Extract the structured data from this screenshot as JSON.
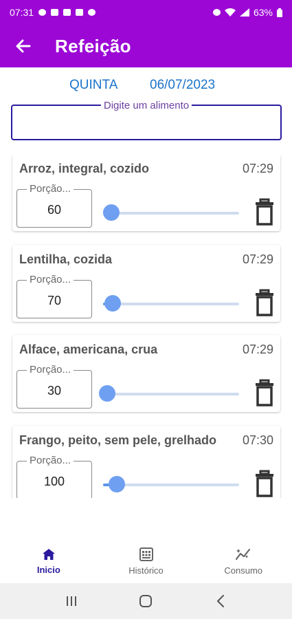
{
  "status_bar": {
    "time": "07:31",
    "battery": "63%"
  },
  "app_bar": {
    "title": "Refeição"
  },
  "date_header": {
    "weekday": "QUINTA",
    "date": "06/07/2023"
  },
  "search": {
    "label": "Digite um alimento",
    "value": ""
  },
  "foods": [
    {
      "name": "Arroz, integral, cozido",
      "time": "07:29",
      "portion_label": "Porção...",
      "portion": "60",
      "slider_fraction": 0.06
    },
    {
      "name": "Lentilha, cozida",
      "time": "07:29",
      "portion_label": "Porção...",
      "portion": "70",
      "slider_fraction": 0.07
    },
    {
      "name": "Alface, americana, crua",
      "time": "07:29",
      "portion_label": "Porção...",
      "portion": "30",
      "slider_fraction": 0.03
    },
    {
      "name": "Frango, peito, sem pele, grelhado",
      "time": "07:30",
      "portion_label": "Porção...",
      "portion": "100",
      "slider_fraction": 0.1
    }
  ],
  "bottom_nav": [
    {
      "label": "Inicio",
      "icon": "home-icon",
      "active": true
    },
    {
      "label": "Histórico",
      "icon": "history-icon",
      "active": false
    },
    {
      "label": "Consumo",
      "icon": "consumption-icon",
      "active": false
    }
  ],
  "colors": {
    "primary": "#9c07d6",
    "accent": "#1a73c9",
    "nav_active": "#2a1a9e",
    "slider": "#6f9ff0"
  }
}
